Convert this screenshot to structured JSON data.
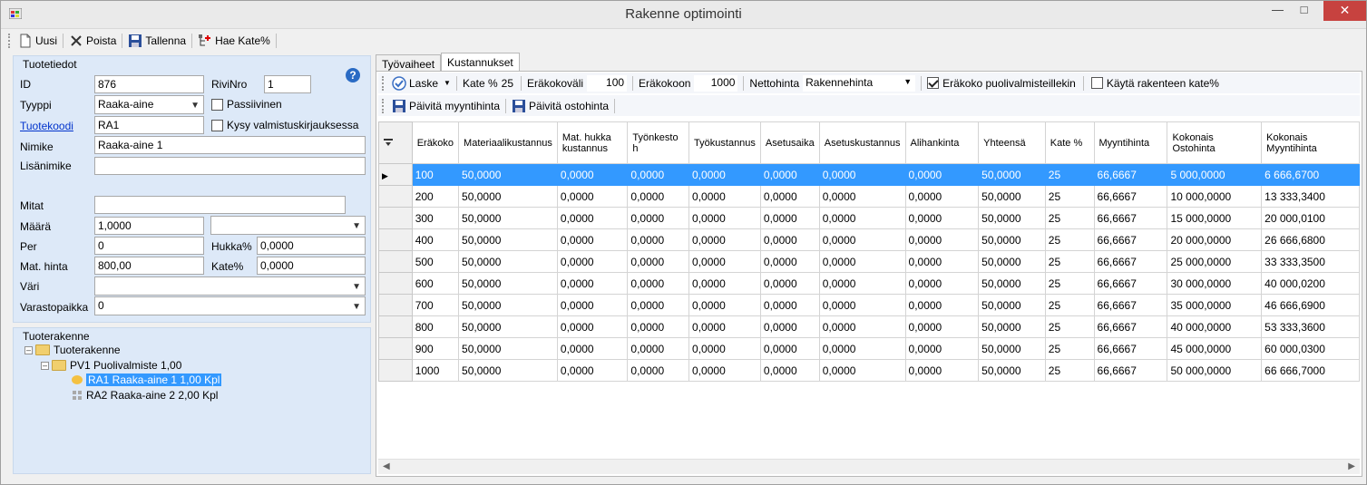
{
  "window": {
    "title": "Rakenne optimointi"
  },
  "toolbar": {
    "new_label": "Uusi",
    "delete_label": "Poista",
    "save_label": "Tallenna",
    "fetch_label": "Hae Kate%"
  },
  "product": {
    "group_title": "Tuotetiedot",
    "id_label": "ID",
    "id_value": "876",
    "rivinro_label": "RiviNro",
    "rivinro_value": "1",
    "tyyppi_label": "Tyyppi",
    "tyyppi_value": "Raaka-aine",
    "passiivinen_label": "Passiivinen",
    "tuotekoodi_label": "Tuotekoodi",
    "tuotekoodi_value": "RA1",
    "kysy_label": "Kysy valmistuskirjauksessa",
    "nimike_label": "Nimike",
    "nimike_value": "Raaka-aine 1",
    "lisanimike_label": "Lisänimike",
    "lisanimike_value": "",
    "mitat_label": "Mitat",
    "mitat_value": "",
    "maara_label": "Määrä",
    "maara_value": "1,0000",
    "maara_unit": "",
    "per_label": "Per",
    "per_value": "0",
    "hukka_label": "Hukka%",
    "hukka_value": "0,0000",
    "mathinta_label": "Mat. hinta",
    "mathinta_value": "800,00",
    "kate_label": "Kate%",
    "kate_value": "0,0000",
    "vari_label": "Väri",
    "vari_value": "",
    "varasto_label": "Varastopaikka",
    "varasto_value": "0"
  },
  "structure": {
    "group_title": "Tuoterakenne",
    "root": "Tuoterakenne",
    "node1": "PV1  Puolivalmiste    1,00",
    "leaf1": "RA1  Raaka-aine 1    1,00 Kpl",
    "leaf2": "RA2  Raaka-aine 2    2,00 Kpl"
  },
  "tabs": {
    "tab1": "Työvaiheet",
    "tab2": "Kustannukset"
  },
  "strip1": {
    "laske": "Laske",
    "kate_label": "Kate %",
    "kate_value": "25",
    "erakokovali_label": "Eräkokoväli",
    "erakokovali_value": "100",
    "erakokoon_label": "Eräkokoon",
    "erakokoon_value": "1000",
    "nettohinta_label": "Nettohinta",
    "nettohinta_value": "Rakennehinta",
    "erakoko_puoli_label": "Eräkoko puolivalmisteillekin",
    "kayta_label": "Käytä rakenteen kate%"
  },
  "strip2": {
    "paivita_myynti": "Päivitä myyntihinta",
    "paivita_osto": "Päivitä ostohinta"
  },
  "grid": {
    "headers": [
      "Eräkoko",
      "Materiaalikustannus",
      "Mat. hukka kustannus",
      "Työnkesto h",
      "Työkustannus",
      "Asetusaika",
      "Asetuskustannus",
      "Alihankinta",
      "Yhteensä",
      "Kate %",
      "Myyntihinta",
      "Kokonais Ostohinta",
      "Kokonais Myyntihinta"
    ],
    "rows": [
      [
        "100",
        "50,0000",
        "0,0000",
        "0,0000",
        "0,0000",
        "0,0000",
        "0,0000",
        "0,0000",
        "50,0000",
        "25",
        "66,6667",
        "5 000,0000",
        "6 666,6700"
      ],
      [
        "200",
        "50,0000",
        "0,0000",
        "0,0000",
        "0,0000",
        "0,0000",
        "0,0000",
        "0,0000",
        "50,0000",
        "25",
        "66,6667",
        "10 000,0000",
        "13 333,3400"
      ],
      [
        "300",
        "50,0000",
        "0,0000",
        "0,0000",
        "0,0000",
        "0,0000",
        "0,0000",
        "0,0000",
        "50,0000",
        "25",
        "66,6667",
        "15 000,0000",
        "20 000,0100"
      ],
      [
        "400",
        "50,0000",
        "0,0000",
        "0,0000",
        "0,0000",
        "0,0000",
        "0,0000",
        "0,0000",
        "50,0000",
        "25",
        "66,6667",
        "20 000,0000",
        "26 666,6800"
      ],
      [
        "500",
        "50,0000",
        "0,0000",
        "0,0000",
        "0,0000",
        "0,0000",
        "0,0000",
        "0,0000",
        "50,0000",
        "25",
        "66,6667",
        "25 000,0000",
        "33 333,3500"
      ],
      [
        "600",
        "50,0000",
        "0,0000",
        "0,0000",
        "0,0000",
        "0,0000",
        "0,0000",
        "0,0000",
        "50,0000",
        "25",
        "66,6667",
        "30 000,0000",
        "40 000,0200"
      ],
      [
        "700",
        "50,0000",
        "0,0000",
        "0,0000",
        "0,0000",
        "0,0000",
        "0,0000",
        "0,0000",
        "50,0000",
        "25",
        "66,6667",
        "35 000,0000",
        "46 666,6900"
      ],
      [
        "800",
        "50,0000",
        "0,0000",
        "0,0000",
        "0,0000",
        "0,0000",
        "0,0000",
        "0,0000",
        "50,0000",
        "25",
        "66,6667",
        "40 000,0000",
        "53 333,3600"
      ],
      [
        "900",
        "50,0000",
        "0,0000",
        "0,0000",
        "0,0000",
        "0,0000",
        "0,0000",
        "0,0000",
        "50,0000",
        "25",
        "66,6667",
        "45 000,0000",
        "60 000,0300"
      ],
      [
        "1000",
        "50,0000",
        "0,0000",
        "0,0000",
        "0,0000",
        "0,0000",
        "0,0000",
        "0,0000",
        "50,0000",
        "25",
        "66,6667",
        "50 000,0000",
        "66 666,7000"
      ]
    ],
    "selected_row": 0
  },
  "colors": {
    "selection": "#3399ff",
    "group_bg": "#dde9f8",
    "close_button": "#c7423f"
  }
}
